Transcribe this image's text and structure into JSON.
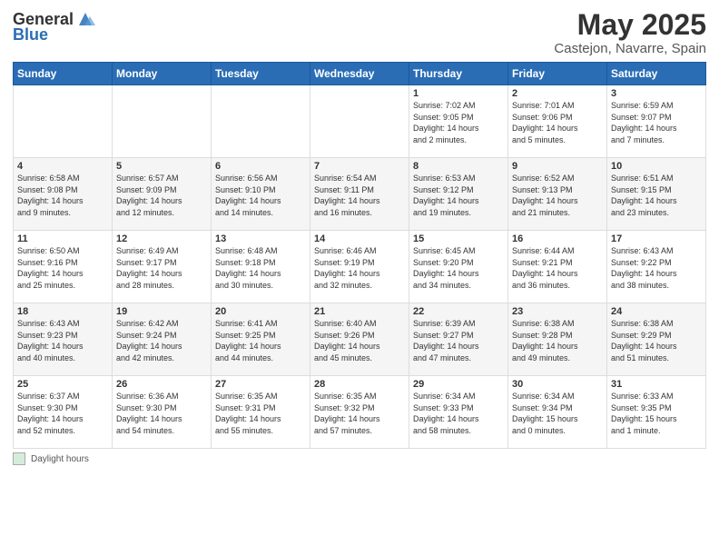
{
  "logo": {
    "general": "General",
    "blue": "Blue"
  },
  "header": {
    "month_year": "May 2025",
    "location": "Castejon, Navarre, Spain"
  },
  "days_of_week": [
    "Sunday",
    "Monday",
    "Tuesday",
    "Wednesday",
    "Thursday",
    "Friday",
    "Saturday"
  ],
  "footer": {
    "daylight_label": "Daylight hours"
  },
  "weeks": [
    {
      "days": [
        {
          "num": "",
          "info": ""
        },
        {
          "num": "",
          "info": ""
        },
        {
          "num": "",
          "info": ""
        },
        {
          "num": "",
          "info": ""
        },
        {
          "num": "1",
          "info": "Sunrise: 7:02 AM\nSunset: 9:05 PM\nDaylight: 14 hours\nand 2 minutes."
        },
        {
          "num": "2",
          "info": "Sunrise: 7:01 AM\nSunset: 9:06 PM\nDaylight: 14 hours\nand 5 minutes."
        },
        {
          "num": "3",
          "info": "Sunrise: 6:59 AM\nSunset: 9:07 PM\nDaylight: 14 hours\nand 7 minutes."
        }
      ]
    },
    {
      "days": [
        {
          "num": "4",
          "info": "Sunrise: 6:58 AM\nSunset: 9:08 PM\nDaylight: 14 hours\nand 9 minutes."
        },
        {
          "num": "5",
          "info": "Sunrise: 6:57 AM\nSunset: 9:09 PM\nDaylight: 14 hours\nand 12 minutes."
        },
        {
          "num": "6",
          "info": "Sunrise: 6:56 AM\nSunset: 9:10 PM\nDaylight: 14 hours\nand 14 minutes."
        },
        {
          "num": "7",
          "info": "Sunrise: 6:54 AM\nSunset: 9:11 PM\nDaylight: 14 hours\nand 16 minutes."
        },
        {
          "num": "8",
          "info": "Sunrise: 6:53 AM\nSunset: 9:12 PM\nDaylight: 14 hours\nand 19 minutes."
        },
        {
          "num": "9",
          "info": "Sunrise: 6:52 AM\nSunset: 9:13 PM\nDaylight: 14 hours\nand 21 minutes."
        },
        {
          "num": "10",
          "info": "Sunrise: 6:51 AM\nSunset: 9:15 PM\nDaylight: 14 hours\nand 23 minutes."
        }
      ]
    },
    {
      "days": [
        {
          "num": "11",
          "info": "Sunrise: 6:50 AM\nSunset: 9:16 PM\nDaylight: 14 hours\nand 25 minutes."
        },
        {
          "num": "12",
          "info": "Sunrise: 6:49 AM\nSunset: 9:17 PM\nDaylight: 14 hours\nand 28 minutes."
        },
        {
          "num": "13",
          "info": "Sunrise: 6:48 AM\nSunset: 9:18 PM\nDaylight: 14 hours\nand 30 minutes."
        },
        {
          "num": "14",
          "info": "Sunrise: 6:46 AM\nSunset: 9:19 PM\nDaylight: 14 hours\nand 32 minutes."
        },
        {
          "num": "15",
          "info": "Sunrise: 6:45 AM\nSunset: 9:20 PM\nDaylight: 14 hours\nand 34 minutes."
        },
        {
          "num": "16",
          "info": "Sunrise: 6:44 AM\nSunset: 9:21 PM\nDaylight: 14 hours\nand 36 minutes."
        },
        {
          "num": "17",
          "info": "Sunrise: 6:43 AM\nSunset: 9:22 PM\nDaylight: 14 hours\nand 38 minutes."
        }
      ]
    },
    {
      "days": [
        {
          "num": "18",
          "info": "Sunrise: 6:43 AM\nSunset: 9:23 PM\nDaylight: 14 hours\nand 40 minutes."
        },
        {
          "num": "19",
          "info": "Sunrise: 6:42 AM\nSunset: 9:24 PM\nDaylight: 14 hours\nand 42 minutes."
        },
        {
          "num": "20",
          "info": "Sunrise: 6:41 AM\nSunset: 9:25 PM\nDaylight: 14 hours\nand 44 minutes."
        },
        {
          "num": "21",
          "info": "Sunrise: 6:40 AM\nSunset: 9:26 PM\nDaylight: 14 hours\nand 45 minutes."
        },
        {
          "num": "22",
          "info": "Sunrise: 6:39 AM\nSunset: 9:27 PM\nDaylight: 14 hours\nand 47 minutes."
        },
        {
          "num": "23",
          "info": "Sunrise: 6:38 AM\nSunset: 9:28 PM\nDaylight: 14 hours\nand 49 minutes."
        },
        {
          "num": "24",
          "info": "Sunrise: 6:38 AM\nSunset: 9:29 PM\nDaylight: 14 hours\nand 51 minutes."
        }
      ]
    },
    {
      "days": [
        {
          "num": "25",
          "info": "Sunrise: 6:37 AM\nSunset: 9:30 PM\nDaylight: 14 hours\nand 52 minutes."
        },
        {
          "num": "26",
          "info": "Sunrise: 6:36 AM\nSunset: 9:30 PM\nDaylight: 14 hours\nand 54 minutes."
        },
        {
          "num": "27",
          "info": "Sunrise: 6:35 AM\nSunset: 9:31 PM\nDaylight: 14 hours\nand 55 minutes."
        },
        {
          "num": "28",
          "info": "Sunrise: 6:35 AM\nSunset: 9:32 PM\nDaylight: 14 hours\nand 57 minutes."
        },
        {
          "num": "29",
          "info": "Sunrise: 6:34 AM\nSunset: 9:33 PM\nDaylight: 14 hours\nand 58 minutes."
        },
        {
          "num": "30",
          "info": "Sunrise: 6:34 AM\nSunset: 9:34 PM\nDaylight: 15 hours\nand 0 minutes."
        },
        {
          "num": "31",
          "info": "Sunrise: 6:33 AM\nSunset: 9:35 PM\nDaylight: 15 hours\nand 1 minute."
        }
      ]
    }
  ]
}
